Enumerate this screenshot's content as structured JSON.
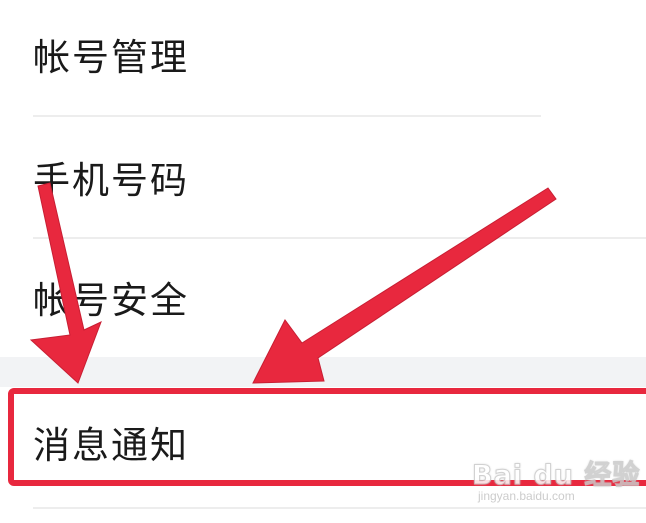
{
  "settings": {
    "items": [
      {
        "label": "帐号管理"
      },
      {
        "label": "手机号码"
      },
      {
        "label": "帐号安全"
      },
      {
        "label": "消息通知"
      }
    ]
  },
  "annotation": {
    "highlight_color": "#e8283e"
  },
  "watermark": {
    "main": "Bai du 经验",
    "sub": "jingyan.baidu.com"
  }
}
